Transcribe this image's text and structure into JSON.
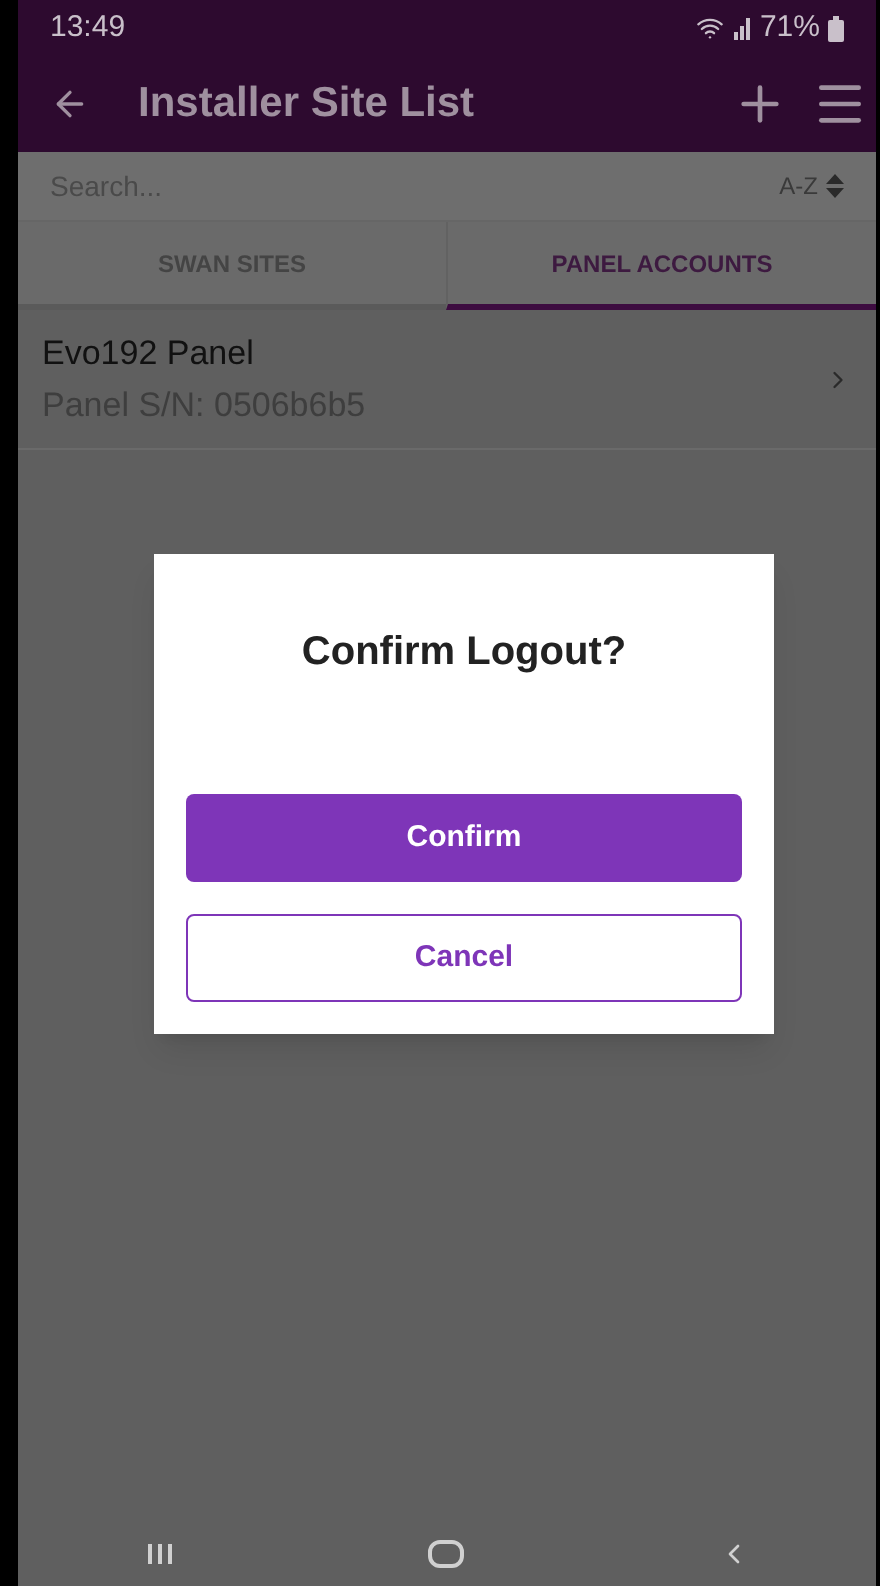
{
  "status_bar": {
    "time": "13:49",
    "battery": "71%"
  },
  "header": {
    "title": "Installer Site List"
  },
  "search": {
    "placeholder": "Search...",
    "sort": "A-Z"
  },
  "tabs": [
    {
      "label": "SWAN SITES",
      "selected": false
    },
    {
      "label": "PANEL ACCOUNTS",
      "selected": true
    }
  ],
  "list": [
    {
      "title": "Evo192 Panel",
      "subtitle": "Panel S/N: 0506b6b5"
    }
  ],
  "dialog": {
    "title": "Confirm Logout?",
    "buttons": [
      {
        "label": "Confirm",
        "kind": "primary"
      },
      {
        "label": "Cancel",
        "kind": "secondary"
      }
    ]
  }
}
